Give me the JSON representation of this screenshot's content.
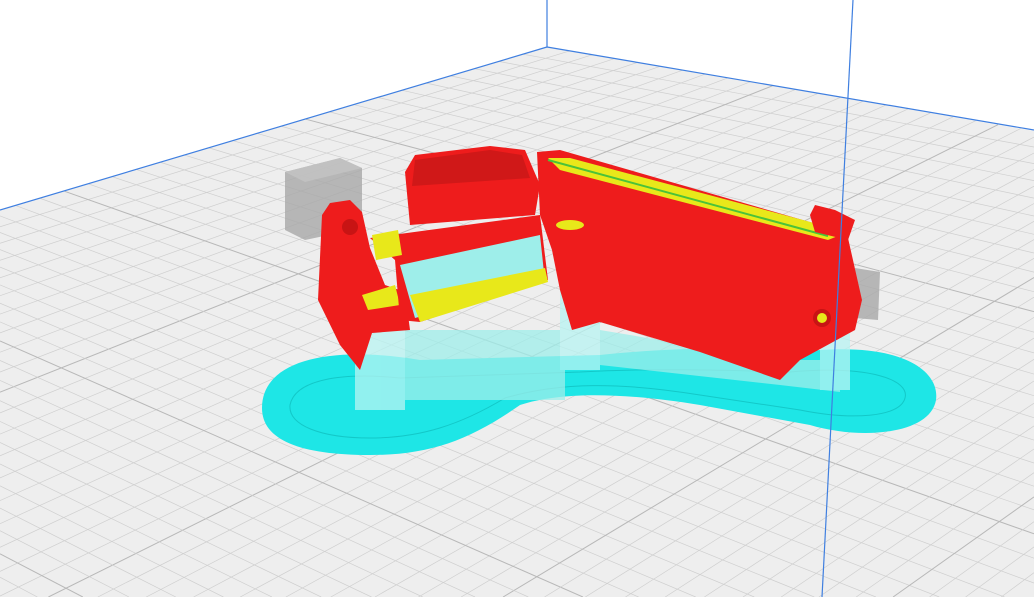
{
  "viewport": {
    "view_mode": "layer-view",
    "colors": {
      "background": "#ffffff",
      "build_plate": "#eeeeee",
      "grid_line": "#cfcfcf",
      "axis_blue": "#3f7fe0",
      "wall_red": "#ee1c1c",
      "wall_red_dark": "#c81414",
      "infill_yellow": "#e8e81a",
      "skin_green": "#4ac23a",
      "brim_cyan": "#1ee6e6",
      "support_cyan": "#a6f0ee",
      "disallowed_gray": "#9a9a9a"
    }
  }
}
